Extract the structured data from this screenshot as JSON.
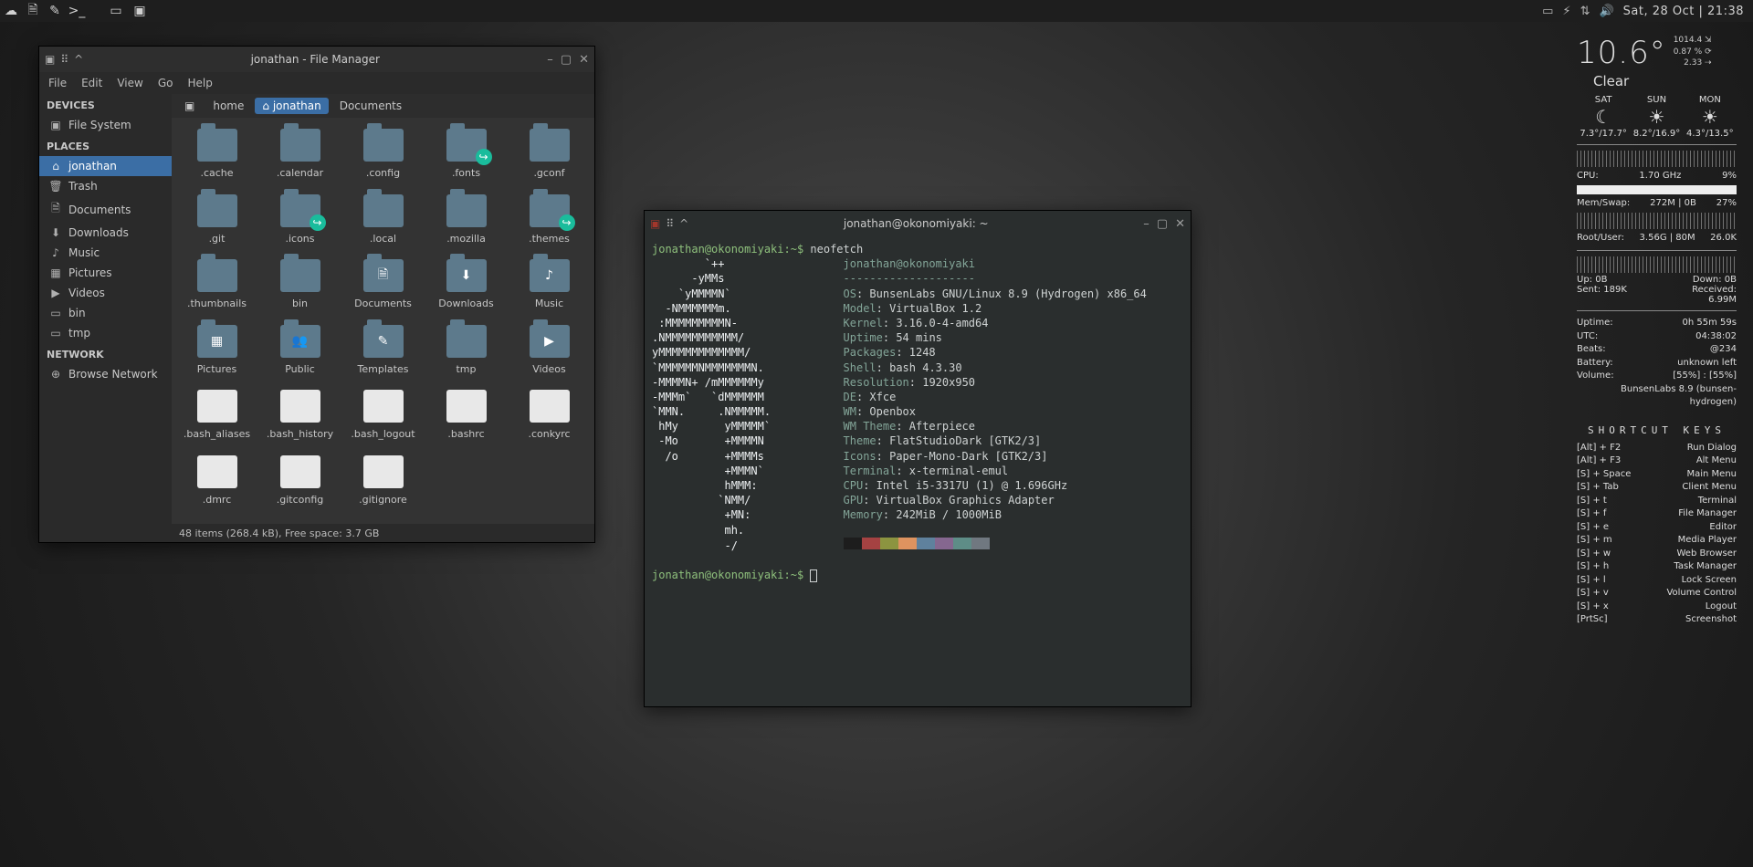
{
  "panel": {
    "launchers": [
      "cloud-icon",
      "files-icon",
      "editor-icon",
      "terminal-icon"
    ],
    "tasks": [
      "filemanager-task-icon",
      "terminal-task-icon"
    ],
    "tray": [
      "window-icon",
      "battery-icon",
      "network-icon",
      "volume-icon"
    ],
    "clock": "Sat, 28 Oct | 21:38"
  },
  "conky": {
    "temp": "10.6°",
    "small": [
      "1014.4 ⇲",
      "0.87 % ⟳",
      "2.33 ⇢"
    ],
    "sky": "Clear",
    "forecast": [
      {
        "day": "SAT",
        "icon": "☾",
        "range": "7.3°/17.7°"
      },
      {
        "day": "SUN",
        "icon": "☀",
        "range": "8.2°/16.9°"
      },
      {
        "day": "MON",
        "icon": "☀",
        "range": "4.3°/13.5°"
      }
    ],
    "cpu": {
      "label": "CPU:",
      "freq": "1.70 GHz",
      "pct": "9%"
    },
    "mem": {
      "label": "Mem/Swap:",
      "val": "272M | 0B",
      "pct": "27%"
    },
    "disk": {
      "label": "Root/User:",
      "val": "3.56G | 80M",
      "pct": "26.0K"
    },
    "net": {
      "up": "Up: 0B",
      "down": "Down: 0B",
      "sent": "Sent: 189K",
      "recv": "Received: 6.99M"
    },
    "sys": [
      {
        "k": "Uptime:",
        "v": "0h 55m 59s"
      },
      {
        "k": "UTC:",
        "v": "04:38:02"
      },
      {
        "k": "Beats:",
        "v": "@234"
      },
      {
        "k": "Battery:",
        "v": "unknown left"
      },
      {
        "k": "Volume:",
        "v": "[55%] : [55%]"
      },
      {
        "k": "",
        "v": "BunsenLabs 8.9 (bunsen-hydrogen)"
      }
    ],
    "shortcut_title": "SHORTCUT KEYS",
    "shortcuts": [
      {
        "k": "[Alt] + F2",
        "v": "Run Dialog"
      },
      {
        "k": "[Alt] + F3",
        "v": "Alt Menu"
      },
      {
        "k": "[S] + Space",
        "v": "Main Menu"
      },
      {
        "k": "[S] + Tab",
        "v": "Client Menu"
      },
      {
        "k": "[S] + t",
        "v": "Terminal"
      },
      {
        "k": "[S] + f",
        "v": "File Manager"
      },
      {
        "k": "[S] + e",
        "v": "Editor"
      },
      {
        "k": "[S] + m",
        "v": "Media Player"
      },
      {
        "k": "[S] + w",
        "v": "Web Browser"
      },
      {
        "k": "[S] + h",
        "v": "Task Manager"
      },
      {
        "k": "[S] + l",
        "v": "Lock Screen"
      },
      {
        "k": "[S] + v",
        "v": "Volume Control"
      },
      {
        "k": "[S] + x",
        "v": "Logout"
      },
      {
        "k": "[PrtSc]",
        "v": "Screenshot"
      }
    ]
  },
  "fm": {
    "title": "jonathan - File Manager",
    "menus": [
      "File",
      "Edit",
      "View",
      "Go",
      "Help"
    ],
    "sidebar": {
      "sections": [
        {
          "header": "DEVICES",
          "items": [
            {
              "icon": "▣",
              "label": "File System"
            }
          ]
        },
        {
          "header": "PLACES",
          "items": [
            {
              "icon": "⌂",
              "label": "jonathan",
              "active": true
            },
            {
              "icon": "🗑",
              "label": "Trash"
            },
            {
              "icon": "🗎",
              "label": "Documents"
            },
            {
              "icon": "⬇",
              "label": "Downloads"
            },
            {
              "icon": "♪",
              "label": "Music"
            },
            {
              "icon": "▦",
              "label": "Pictures"
            },
            {
              "icon": "▶",
              "label": "Videos"
            },
            {
              "icon": "▭",
              "label": "bin"
            },
            {
              "icon": "▭",
              "label": "tmp"
            }
          ]
        },
        {
          "header": "NETWORK",
          "items": [
            {
              "icon": "⊕",
              "label": "Browse Network"
            }
          ]
        }
      ]
    },
    "path": [
      {
        "icon": "▣",
        "label": ""
      },
      {
        "label": "home"
      },
      {
        "icon": "⌂",
        "label": "jonathan",
        "active": true
      },
      {
        "label": "Documents"
      }
    ],
    "items": [
      {
        "name": ".cache",
        "type": "folder"
      },
      {
        "name": ".calendar",
        "type": "folder"
      },
      {
        "name": ".config",
        "type": "folder"
      },
      {
        "name": ".fonts",
        "type": "folder",
        "badge": "↪"
      },
      {
        "name": ".gconf",
        "type": "folder"
      },
      {
        "name": ".git",
        "type": "folder"
      },
      {
        "name": ".icons",
        "type": "folder",
        "badge": "↪"
      },
      {
        "name": ".local",
        "type": "folder"
      },
      {
        "name": ".mozilla",
        "type": "folder"
      },
      {
        "name": ".themes",
        "type": "folder",
        "badge": "↪"
      },
      {
        "name": ".thumbnails",
        "type": "folder"
      },
      {
        "name": "bin",
        "type": "folder"
      },
      {
        "name": "Documents",
        "type": "folder",
        "inner": "🗎"
      },
      {
        "name": "Downloads",
        "type": "folder",
        "inner": "⬇"
      },
      {
        "name": "Music",
        "type": "folder",
        "inner": "♪"
      },
      {
        "name": "Pictures",
        "type": "folder",
        "inner": "▦"
      },
      {
        "name": "Public",
        "type": "folder",
        "inner": "👥"
      },
      {
        "name": "Templates",
        "type": "folder",
        "inner": "✎"
      },
      {
        "name": "tmp",
        "type": "folder"
      },
      {
        "name": "Videos",
        "type": "folder",
        "inner": "▶"
      },
      {
        "name": ".bash_aliases",
        "type": "file"
      },
      {
        "name": ".bash_history",
        "type": "file"
      },
      {
        "name": ".bash_logout",
        "type": "file"
      },
      {
        "name": ".bashrc",
        "type": "file"
      },
      {
        "name": ".conkyrc",
        "type": "file"
      },
      {
        "name": ".dmrc",
        "type": "file"
      },
      {
        "name": ".gitconfig",
        "type": "file"
      },
      {
        "name": ".gitignore",
        "type": "file"
      }
    ],
    "status": "48 items (268.4 kB), Free space: 3.7 GB"
  },
  "term": {
    "title": "jonathan@okonomiyaki: ~",
    "prompt1": "jonathan@okonomiyaki:~$ ",
    "cmd": "neofetch",
    "ascii": [
      "        `++                ",
      "      -yMMs               ",
      "    `yMMMMN`              ",
      "  -NMMMMMMm.             ",
      " :MMMMMMMMMN-            ",
      ".NMMMMMMMMMMM/           ",
      "yMMMMMMMMMMMMM/          ",
      "`MMMMMMNMMMMMMMN.         ",
      "-MMMMN+ /mMMMMMMy        ",
      "-MMMm`   `dMMMMMM       ",
      "`MMN.     .NMMMMM.      ",
      " hMy       yMMMMM`      ",
      " -Mo       +MMMMN       ",
      "  /o       +MMMMs       ",
      "           +MMMN`       ",
      "           hMMM:        ",
      "          `NMM/         ",
      "           +MN:          ",
      "           mh.           ",
      "           -/            "
    ],
    "info": [
      {
        "k": "jonathan@okonomiyaki",
        "v": ""
      },
      {
        "k": "--------------------",
        "v": ""
      },
      {
        "k": "OS",
        "v": "BunsenLabs GNU/Linux 8.9 (Hydrogen) x86_64"
      },
      {
        "k": "Model",
        "v": "VirtualBox 1.2"
      },
      {
        "k": "Kernel",
        "v": "3.16.0-4-amd64"
      },
      {
        "k": "Uptime",
        "v": "54 mins"
      },
      {
        "k": "Packages",
        "v": "1248"
      },
      {
        "k": "Shell",
        "v": "bash 4.3.30"
      },
      {
        "k": "Resolution",
        "v": "1920x950"
      },
      {
        "k": "DE",
        "v": "Xfce"
      },
      {
        "k": "WM",
        "v": "Openbox"
      },
      {
        "k": "WM Theme",
        "v": "Afterpiece"
      },
      {
        "k": "Theme",
        "v": "FlatStudioDark [GTK2/3]"
      },
      {
        "k": "Icons",
        "v": "Paper-Mono-Dark [GTK2/3]"
      },
      {
        "k": "Terminal",
        "v": "x-terminal-emul"
      },
      {
        "k": "CPU",
        "v": "Intel i5-3317U (1) @ 1.696GHz"
      },
      {
        "k": "GPU",
        "v": "VirtualBox Graphics Adapter"
      },
      {
        "k": "Memory",
        "v": "242MiB / 1000MiB"
      }
    ],
    "colors": [
      "#1d1d1d",
      "#a54242",
      "#8c9440",
      "#de935f",
      "#5f819d",
      "#85678f",
      "#5e8d87",
      "#707880"
    ],
    "prompt2": "jonathan@okonomiyaki:~$ "
  }
}
